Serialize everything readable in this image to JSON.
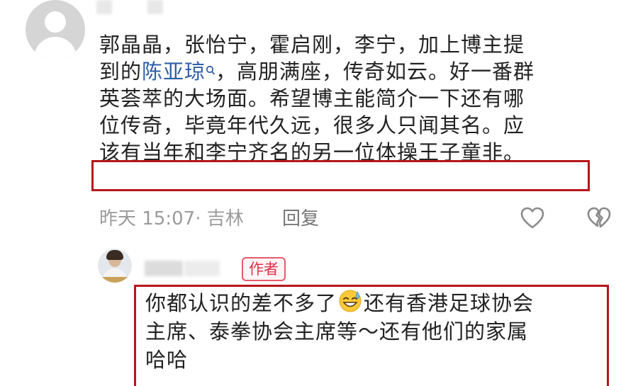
{
  "comment": {
    "lines": [
      "郭晶晶，张怡宁，霍启刚，李宁，加上博主提",
      "到的",
      "，高朋满座，传奇如云。好一番群",
      "英荟萃的大场面。希望博主能简介一下还有哪",
      "位传奇，毕竟年代久远，很多人只闻其名。应",
      "该有当年和李宁齐名的另一位体操王子童非。"
    ],
    "link_text": "陈亚琼",
    "search_icon": "search-icon",
    "time_location": "昨天 15:07· 吉林",
    "reply_label": "回复",
    "like_icon": "heart-icon",
    "dislike_icon": "broken-heart-icon"
  },
  "reply": {
    "badge": "作者",
    "lines": [
      "你都认识的差不多了",
      "还有香港足球协会",
      "主席、泰拳协会主席等～还有他们的家属",
      "哈哈"
    ],
    "emoji": "sweat-smile-emoji"
  },
  "colors": {
    "highlight_border": "#b5161b",
    "link": "#2f5fa6",
    "badge": "#e0304a",
    "meta_text": "#9b9b9b"
  }
}
